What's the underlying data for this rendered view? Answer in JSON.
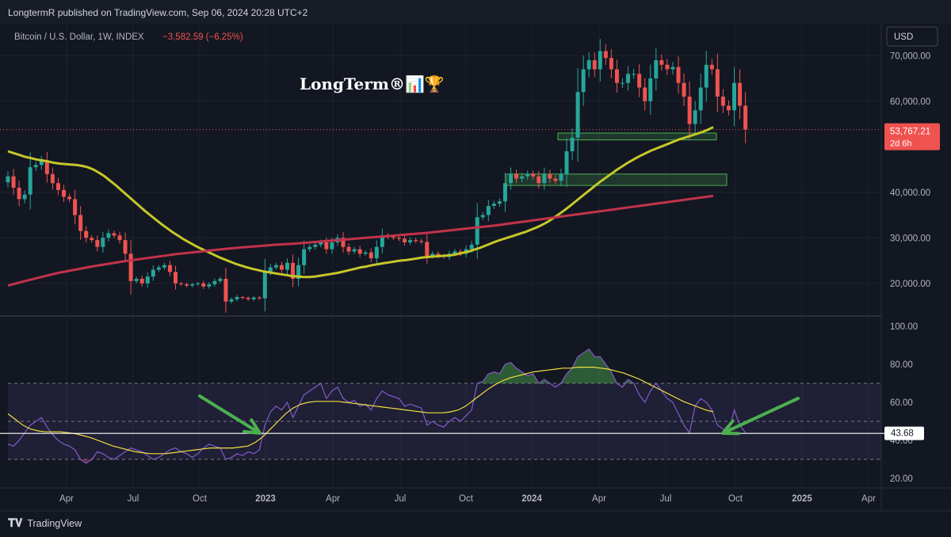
{
  "header": {
    "published": "LongtermR published on TradingView.com, Sep 06, 2024 20:28 UTC+2"
  },
  "symbol": {
    "name": "Bitcoin / U.S. Dollar, 1W, INDEX",
    "change": "−3,582.59 (−6.25%)"
  },
  "watermark": "LongTerm®📊🏆",
  "currency_button": "USD",
  "last_price": {
    "value": "53,767.21",
    "countdown": "2d 6h",
    "numeric": 53767.21
  },
  "rsi_readout": {
    "value": "43.68",
    "numeric": 43.68
  },
  "footer": {
    "brand": "TradingView"
  },
  "colors": {
    "up": "#26a69a",
    "down": "#ef5350",
    "ma_short": "#c5c72a",
    "ma_long": "#c2334a",
    "rsi": "#7e57c2",
    "rsi_ma": "#f0e040",
    "zone": "#4caf50",
    "arrow": "#4caf50"
  },
  "chart_data": [
    {
      "type": "candlestick",
      "title": "Bitcoin / U.S. Dollar, 1W, INDEX",
      "x_tick_labels": [
        "Apr",
        "Jul",
        "Oct",
        "2023",
        "Apr",
        "Jul",
        "Oct",
        "2024",
        "Apr",
        "Jul",
        "Oct",
        "2025",
        "Apr"
      ],
      "x_tick_values": [
        "2022-04",
        "2022-07",
        "2022-10",
        "2023-01",
        "2023-04",
        "2023-07",
        "2023-10",
        "2024-01",
        "2024-04",
        "2024-07",
        "2024-10",
        "2025-01",
        "2025-04"
      ],
      "y_tick_labels": [
        "20,000.00",
        "30,000.00",
        "40,000.00",
        "60,000.00",
        "70,000.00"
      ],
      "y_tick_values": [
        20000,
        30000,
        40000,
        60000,
        70000
      ],
      "ylim": [
        13000,
        77000
      ],
      "close_series": [
        43500,
        41000,
        38500,
        39500,
        45500,
        46000,
        47000,
        44000,
        42000,
        40500,
        39000,
        38500,
        35000,
        31500,
        30000,
        29500,
        28000,
        30000,
        31000,
        30500,
        29500,
        26500,
        20500,
        21000,
        20000,
        21500,
        23000,
        23500,
        24000,
        22500,
        20000,
        19800,
        19500,
        19800,
        20000,
        19300,
        19800,
        20500,
        21000,
        16000,
        16500,
        17000,
        16800,
        16500,
        16900,
        16700,
        22500,
        23500,
        24000,
        23000,
        24500,
        21000,
        24000,
        27500,
        28000,
        28500,
        29000,
        27500,
        29000,
        30000,
        28000,
        27000,
        27500,
        26500,
        26800,
        25500,
        28000,
        30500,
        30200,
        30000,
        29800,
        29000,
        29500,
        29300,
        29100,
        26000,
        26500,
        26000,
        25800,
        26500,
        27000,
        26500,
        27500,
        28500,
        34500,
        35000,
        37000,
        37500,
        38000,
        42000,
        44000,
        43000,
        43500,
        44000,
        43500,
        42000,
        44000,
        43000,
        42500,
        44000,
        49000,
        52000,
        62000,
        67000,
        69000,
        67000,
        71000,
        69500,
        67000,
        64000,
        64000,
        66000,
        66000,
        63000,
        60000,
        65000,
        69000,
        68000,
        67000,
        67500,
        64000,
        61000,
        55000,
        58000,
        63000,
        68000,
        67000,
        61000,
        59000,
        58000,
        64000,
        59000,
        53767
      ],
      "series": [
        {
          "name": "",
          "type": "ma_short",
          "values": [
            49000,
            48600,
            48200,
            47800,
            47500,
            47200,
            47000,
            46800,
            46500,
            46300,
            46200,
            46100,
            46000,
            45800,
            45500,
            45000,
            44300,
            43500,
            42500,
            41500,
            40400,
            39300,
            38200,
            37100,
            36000,
            35000,
            34000,
            33000,
            32100,
            31200,
            30400,
            29600,
            28900,
            28200,
            27600,
            27000,
            26400,
            25800,
            25300,
            24800,
            24300,
            23900,
            23500,
            23200,
            22900,
            22600,
            22400,
            22200,
            22000,
            21800,
            21600,
            21500,
            21400,
            21400,
            21500,
            21700,
            21900,
            22100,
            22300,
            22600,
            22900,
            23200,
            23500,
            23700,
            24000,
            24200,
            24400,
            24600,
            24800,
            25000,
            25100,
            25300,
            25500,
            25700,
            25800,
            25900,
            26000,
            26100,
            26200,
            26400,
            26700,
            27000,
            27400,
            27800,
            28300,
            28800,
            29300,
            29700,
            30100,
            30500,
            30900,
            31300,
            31800,
            32300,
            32900,
            33600,
            34400,
            35300,
            36200,
            37200,
            38200,
            39200,
            40200,
            41200,
            42200,
            43100,
            44000,
            44900,
            45700,
            46500,
            47200,
            47900,
            48500,
            49100,
            49600,
            50100,
            50600,
            51100,
            51600,
            52000,
            52400,
            52800,
            53200,
            53700,
            54300
          ]
        },
        {
          "name": "",
          "type": "ma_long",
          "values": [
            19500,
            20500,
            21400,
            22300,
            23000,
            23700,
            24300,
            24900,
            25400,
            25900,
            26400,
            26800,
            27200,
            27600,
            27900,
            28200,
            28500,
            28700,
            29000,
            29300,
            29600,
            29900,
            30200,
            30500,
            30800,
            31100,
            31500,
            31900,
            32300,
            32700,
            33200,
            33700,
            34200,
            34700,
            35200,
            35700,
            36200,
            36700,
            37200,
            37700,
            38200,
            38700,
            39200
          ]
        },
        {
          "name": "",
          "type": "rsi",
          "values": [
            38,
            37,
            40,
            44,
            48,
            50,
            52,
            47,
            43,
            40,
            38,
            37,
            35,
            30,
            28,
            30,
            34,
            33,
            31,
            30,
            32,
            34,
            36,
            35,
            34,
            32,
            30,
            31,
            33,
            35,
            36,
            34,
            33,
            31,
            33,
            36,
            38,
            37,
            36,
            30,
            31,
            33,
            32,
            34,
            33,
            35,
            48,
            55,
            58,
            56,
            60,
            52,
            58,
            64,
            66,
            68,
            70,
            62,
            66,
            68,
            62,
            60,
            61,
            58,
            59,
            56,
            62,
            66,
            64,
            63,
            62,
            58,
            59,
            58,
            57,
            48,
            50,
            48,
            47,
            50,
            52,
            50,
            53,
            56,
            70,
            71,
            75,
            76,
            75,
            80,
            81,
            78,
            76,
            74,
            75,
            70,
            72,
            70,
            68,
            70,
            75,
            78,
            84,
            86,
            88,
            84,
            84,
            80,
            76,
            70,
            68,
            72,
            70,
            64,
            60,
            66,
            70,
            66,
            62,
            60,
            54,
            48,
            44,
            58,
            62,
            60,
            56,
            48,
            46,
            44,
            56,
            48,
            44
          ]
        },
        {
          "name": "",
          "type": "rsi_ma",
          "values": [
            54,
            51,
            48,
            46,
            45,
            44.5,
            44.5,
            44.5,
            44,
            43.5,
            42.5,
            41.5,
            40,
            38.5,
            37,
            36,
            35,
            34,
            33.5,
            33,
            33,
            33,
            33.5,
            34,
            34.5,
            35,
            35.5,
            36,
            36,
            36,
            36,
            36.5,
            37,
            39,
            42,
            46,
            50,
            54,
            57,
            59,
            60,
            60.5,
            60.5,
            60.5,
            60.5,
            60,
            59.5,
            59,
            58.5,
            58,
            57.5,
            57,
            56.5,
            56,
            55.5,
            55,
            54.5,
            54.5,
            54.5,
            55,
            56,
            58,
            61,
            64,
            67,
            69.5,
            71.5,
            73,
            74,
            75,
            76,
            76.5,
            77,
            77.5,
            78,
            78,
            78.5,
            78.5,
            78.5,
            78,
            77.5,
            76.5,
            75.5,
            74,
            72.5,
            70.5,
            68.5,
            66.5,
            64.5,
            62.5,
            60.5,
            59,
            57.5,
            56,
            55
          ]
        }
      ],
      "rsi_ylim": [
        15,
        105
      ],
      "rsi_y_tick_labels": [
        "20.00",
        "40.00",
        "60.00",
        "80.00",
        "100.00"
      ],
      "rsi_y_tick_values": [
        20,
        40,
        60,
        80,
        100
      ],
      "rsi_band": [
        30,
        70
      ],
      "rsi_mid": 50,
      "rsi_horizontal_line": 43.68,
      "support_zones": [
        {
          "from": 51500,
          "to": 53000
        },
        {
          "from": 41500,
          "to": 44000
        }
      ],
      "grid": true
    }
  ]
}
